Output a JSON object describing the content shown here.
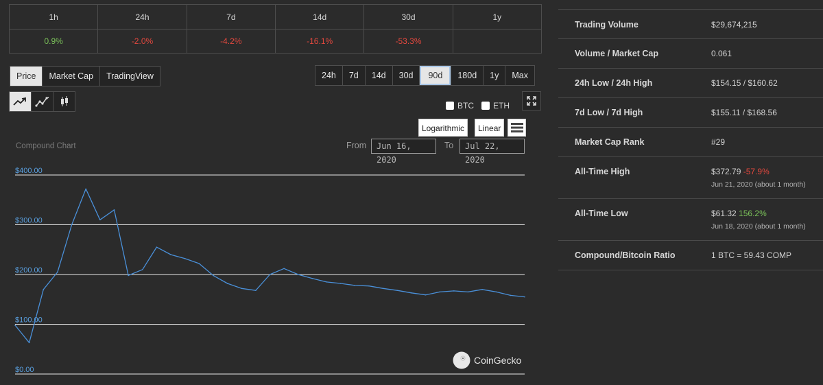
{
  "changes": {
    "headers": [
      "1h",
      "24h",
      "7d",
      "14d",
      "30d",
      "1y"
    ],
    "values": [
      "0.9%",
      "-2.0%",
      "-4.2%",
      "-16.1%",
      "-53.3%",
      ""
    ],
    "directions": [
      "pos",
      "neg",
      "neg",
      "neg",
      "neg",
      "none"
    ]
  },
  "view_tabs": [
    "Price",
    "Market Cap",
    "TradingView"
  ],
  "range_tabs": [
    "24h",
    "7d",
    "14d",
    "30d",
    "90d",
    "180d",
    "1y",
    "Max"
  ],
  "active_range": "90d",
  "chart_style_icons": [
    "line-chart-icon",
    "smooth-line-icon",
    "candlestick-icon"
  ],
  "compare": {
    "btc": "BTC",
    "eth": "ETH"
  },
  "scale": {
    "log": "Logarithmic",
    "linear": "Linear"
  },
  "date_range": {
    "from_label": "From",
    "from": "Jun 16, 2020",
    "to_label": "To",
    "to": "Jul 22, 2020"
  },
  "chart_label": "Compound Chart",
  "watermark": "CoinGecko",
  "colors": {
    "line": "#4a90d9",
    "positive": "#7cc35a",
    "negative": "#e4483e"
  },
  "chart_data": {
    "type": "line",
    "yticks": [
      "$400.00",
      "$300.00",
      "$200.00",
      "$100.00",
      "$0.00"
    ],
    "ylim": [
      0,
      400
    ],
    "xlim": [
      "2020-06-16",
      "2020-07-22"
    ],
    "series": [
      {
        "x": [
          "2020-06-16",
          "2020-06-17",
          "2020-06-18",
          "2020-06-19",
          "2020-06-20",
          "2020-06-21",
          "2020-06-22",
          "2020-06-23",
          "2020-06-24",
          "2020-06-25",
          "2020-06-26",
          "2020-06-27",
          "2020-06-28",
          "2020-06-29",
          "2020-06-30",
          "2020-07-01",
          "2020-07-02",
          "2020-07-03",
          "2020-07-04",
          "2020-07-05",
          "2020-07-06",
          "2020-07-07",
          "2020-07-08",
          "2020-07-09",
          "2020-07-10",
          "2020-07-11",
          "2020-07-12",
          "2020-07-13",
          "2020-07-14",
          "2020-07-15",
          "2020-07-16",
          "2020-07-17",
          "2020-07-18",
          "2020-07-19",
          "2020-07-20",
          "2020-07-21",
          "2020-07-22"
        ],
        "y": [
          98,
          63,
          170,
          205,
          300,
          372,
          310,
          330,
          198,
          210,
          255,
          240,
          232,
          222,
          198,
          182,
          172,
          168,
          200,
          212,
          200,
          192,
          185,
          182,
          178,
          177,
          172,
          168,
          163,
          159,
          165,
          167,
          165,
          170,
          165,
          158,
          155
        ]
      }
    ]
  },
  "stats": [
    {
      "label": "Trading Volume",
      "value": "$29,674,215"
    },
    {
      "label": "Volume / Market Cap",
      "value": "0.061"
    },
    {
      "label": "24h Low / 24h High",
      "value": "$154.15 / $160.62"
    },
    {
      "label": "7d Low / 7d High",
      "value": "$155.11 / $168.56"
    },
    {
      "label": "Market Cap Rank",
      "value": "#29"
    },
    {
      "label": "All-Time High",
      "value": "$372.79",
      "change": "-57.9%",
      "note": "Jun 21, 2020 (about 1 month)"
    },
    {
      "label": "All-Time Low",
      "value": "$61.32",
      "change": "156.2%",
      "note": "Jun 18, 2020 (about 1 month)"
    },
    {
      "label": "Compound/Bitcoin Ratio",
      "value": "1 BTC = 59.43 COMP"
    }
  ]
}
